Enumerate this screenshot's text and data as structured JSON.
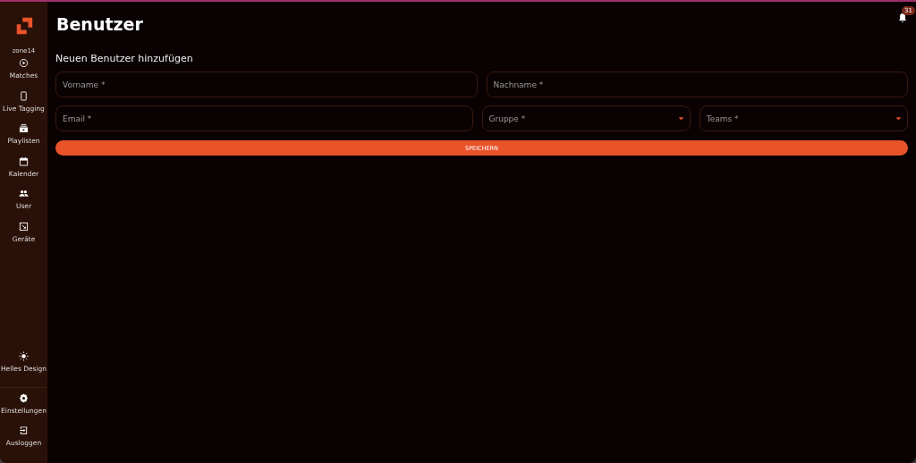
{
  "sidebar": {
    "brand": "zone14",
    "items": [
      {
        "label": "Matches"
      },
      {
        "label": "Live Tagging"
      },
      {
        "label": "Playlisten"
      },
      {
        "label": "Kalender"
      },
      {
        "label": "User"
      },
      {
        "label": "Geräte"
      }
    ],
    "bottom_items": [
      {
        "label": "Helles Design"
      },
      {
        "label": "Einstellungen"
      },
      {
        "label": "Ausloggen"
      }
    ]
  },
  "header": {
    "title": "Benutzer",
    "notifications": "31"
  },
  "form": {
    "heading": "Neuen Benutzer hinzufügen",
    "rows": [
      [
        {
          "kind": "text",
          "placeholder": "Vorname *"
        },
        {
          "kind": "text",
          "placeholder": "Nachname *"
        }
      ],
      [
        {
          "kind": "text",
          "placeholder": "Email *"
        },
        {
          "kind": "select",
          "placeholder": "Gruppe *"
        },
        {
          "kind": "select",
          "placeholder": "Teams *"
        }
      ]
    ],
    "submit": "SPEICHERN"
  }
}
